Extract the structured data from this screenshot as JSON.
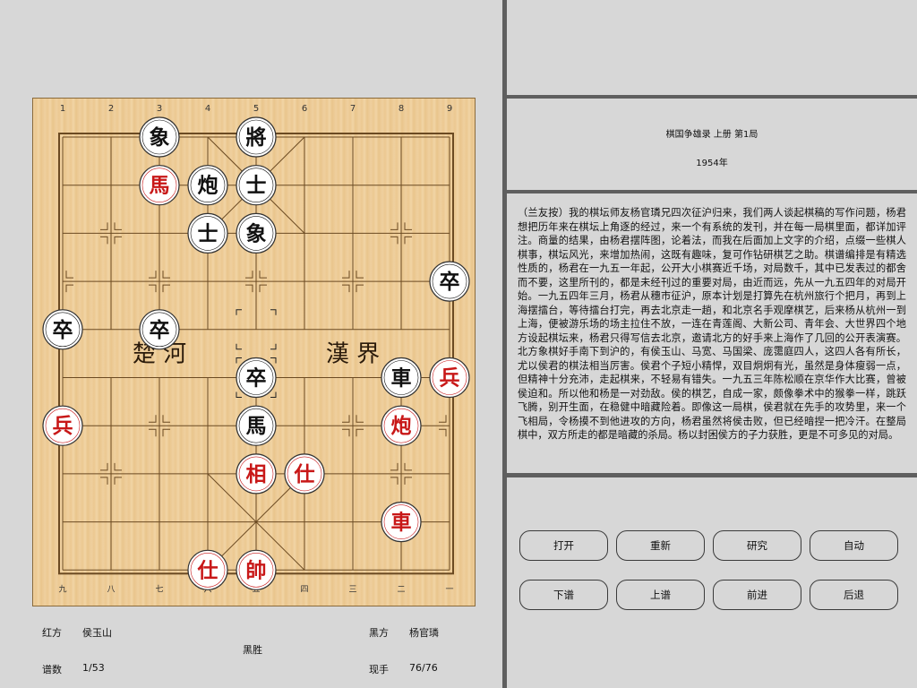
{
  "board": {
    "top_files": [
      "1",
      "2",
      "3",
      "4",
      "5",
      "6",
      "7",
      "8",
      "9"
    ],
    "bottom_files": [
      "九",
      "八",
      "七",
      "六",
      "五",
      "四",
      "三",
      "二",
      "一"
    ],
    "river_left": "楚  河",
    "river_right": "漢  界",
    "pieces": [
      {
        "char": "象",
        "side": "black",
        "file": 3,
        "rank": 0
      },
      {
        "char": "將",
        "side": "black",
        "file": 5,
        "rank": 0
      },
      {
        "char": "馬",
        "side": "red",
        "file": 3,
        "rank": 1
      },
      {
        "char": "炮",
        "side": "black",
        "file": 4,
        "rank": 1
      },
      {
        "char": "士",
        "side": "black",
        "file": 5,
        "rank": 1
      },
      {
        "char": "士",
        "side": "black",
        "file": 4,
        "rank": 2
      },
      {
        "char": "象",
        "side": "black",
        "file": 5,
        "rank": 2
      },
      {
        "char": "卒",
        "side": "black",
        "file": 9,
        "rank": 3
      },
      {
        "char": "卒",
        "side": "black",
        "file": 1,
        "rank": 4
      },
      {
        "char": "卒",
        "side": "black",
        "file": 3,
        "rank": 4
      },
      {
        "char": "卒",
        "side": "black",
        "file": 5,
        "rank": 5
      },
      {
        "char": "車",
        "side": "black",
        "file": 8,
        "rank": 5
      },
      {
        "char": "兵",
        "side": "red",
        "file": 9,
        "rank": 5
      },
      {
        "char": "兵",
        "side": "red",
        "file": 1,
        "rank": 6
      },
      {
        "char": "馬",
        "side": "black",
        "file": 5,
        "rank": 6
      },
      {
        "char": "炮",
        "side": "red",
        "file": 8,
        "rank": 6
      },
      {
        "char": "相",
        "side": "red",
        "file": 5,
        "rank": 7
      },
      {
        "char": "仕",
        "side": "red",
        "file": 6,
        "rank": 7
      },
      {
        "char": "車",
        "side": "red",
        "file": 8,
        "rank": 8
      },
      {
        "char": "仕",
        "side": "red",
        "file": 4,
        "rank": 9
      },
      {
        "char": "帥",
        "side": "red",
        "file": 5,
        "rank": 9
      }
    ],
    "last_move": {
      "from": {
        "file": 5,
        "rank": 4
      },
      "to": {
        "file": 5,
        "rank": 5
      }
    }
  },
  "info": {
    "red_label": "红方",
    "red_player": "侯玉山",
    "black_label": "黑方",
    "black_player": "杨官璘",
    "result": "黑胜",
    "moves_label": "谱数",
    "moves_value": "1/53",
    "current_label": "现手",
    "current_value": "76/76"
  },
  "game_title": "棋国争雄录 上册 第1局",
  "game_year": "1954年",
  "comment": "（兰友按）我的棋坛师友杨官璘兄四次征沪归来，我们两人谈起棋稿的写作问题，杨君想把历年来在棋坛上角逐的经过，来一个有系统的发刊，并在每一局棋里面，都详加评注。商量的结果，由杨君摆阵图，论着法，而我在后面加上文字的介绍，点缀一些棋人棋事，棋坛风光，来增加热闹，这既有趣味，复可作钻研棋艺之助。棋谱编排是有精选性质的，杨君在一九五一年起，公开大小棋赛近千场，对局数千，其中已发表过的都舍而不要，这里所刊的，都是未经刊过的重要对局，由近而远，先从一九五四年的对局开始。一九五四年三月，杨君从穗市征沪，原本计划是打算先在杭州旅行个把月，再到上海摆擂台，等待擂台打完，再去北京走一趟，和北京名手观摩棋艺，后来杨从杭州一到上海，便被游乐场的场主拉住不放，一连在青莲阁、大新公司、青年会、大世界四个地方设起棋坛来，杨君只得写信去北京，邀请北方的好手来上海作了几回的公开表演赛。北方象棋好手南下到沪的，有侯玉山、马宽、马国梁、庞霭庭四人，这四人各有所长，尤以侯君的棋法相当厉害。侯君个子短小精悍，双目炯炯有光，虽然是身体瘦弱一点，但精神十分充沛，走起棋来，不轻易有错失。一九五三年陈松顺在京华作大比赛，曾被侯迫和。所以他和杨是一对劲敌。侯的棋艺，自成一家，颇像拳术中的猴拳一样，跳跃飞腾，别开生面，在稳健中暗藏险着。即像这一局棋，侯君就在先手的攻势里，来一个飞相局，令杨摸不到他进攻的方向，杨君虽然将侯击败，但已经暗捏一把冷汗。在整局棋中，双方所走的都是暗藏的杀局。杨以封困侯方的子力获胜，更是不可多见的对局。",
  "buttons": {
    "open": "打开",
    "restart": "重新",
    "research": "研究",
    "auto": "自动",
    "next_game": "下谱",
    "prev_game": "上谱",
    "forward": "前进",
    "back": "后退"
  },
  "colors": {
    "red_piece": "#c81818",
    "black_piece": "#111111",
    "board_line": "#6b4a22",
    "panel_bg": "#d7d7d7",
    "divider": "#5f5f5f"
  }
}
